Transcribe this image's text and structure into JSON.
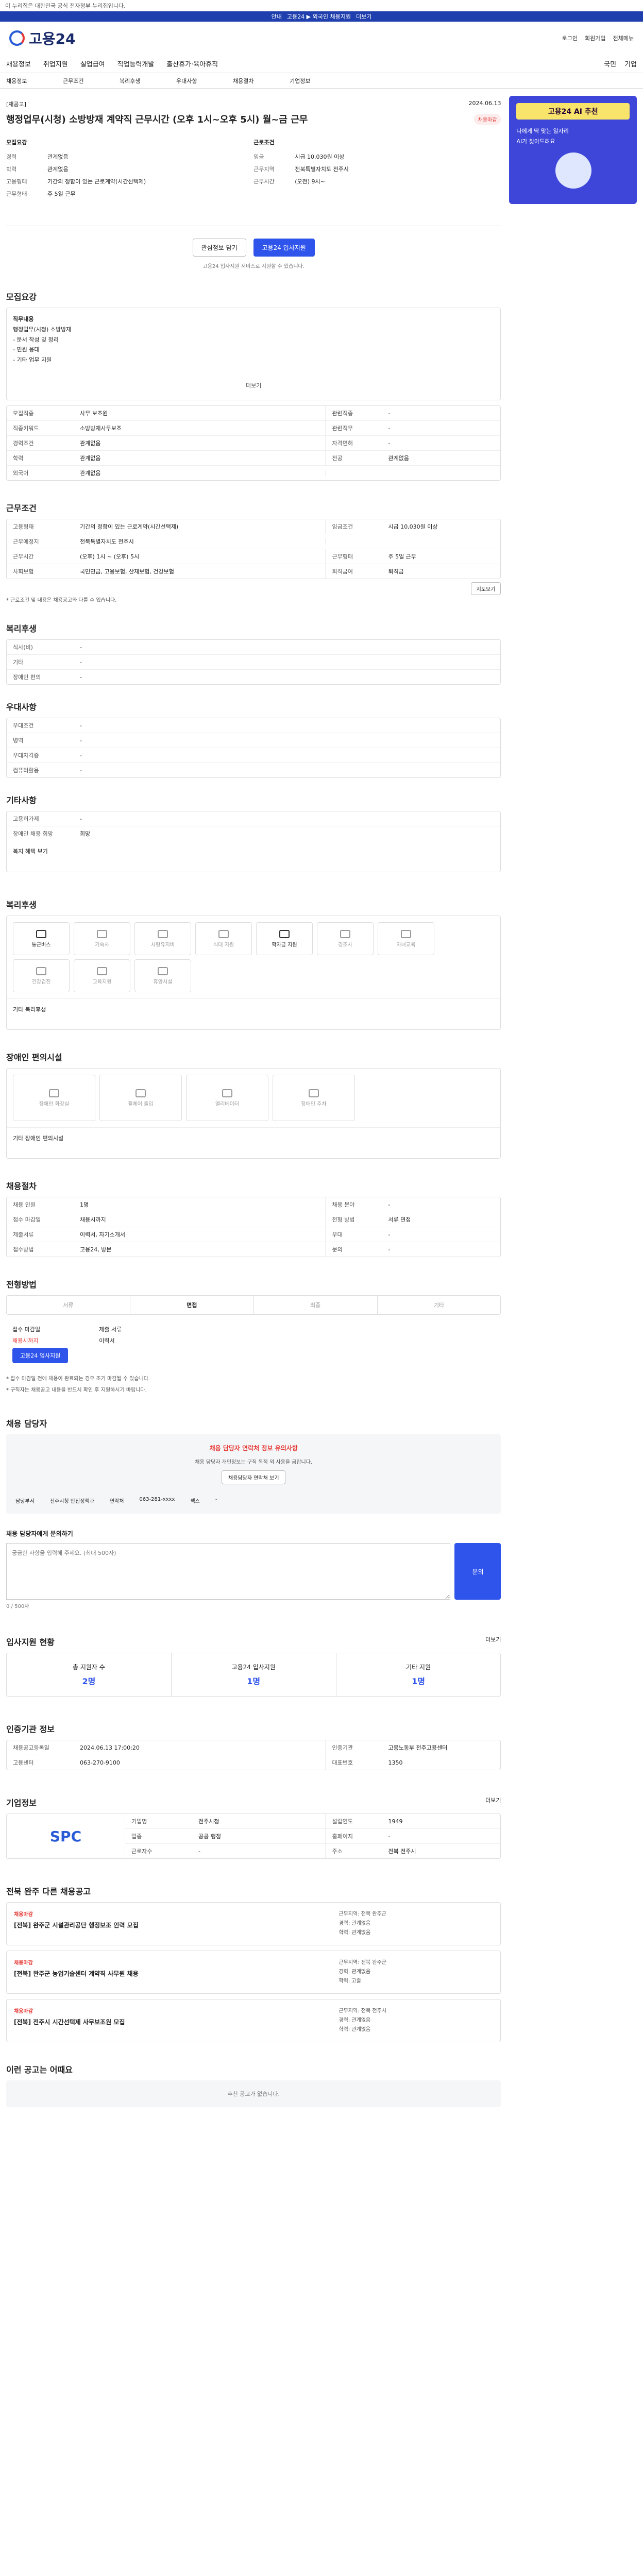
{
  "topbar": {
    "text": "이 누리집은 대한민국 공식 전자정부 누리집입니다."
  },
  "bluebar": {
    "badge": "안내",
    "text": "고용24 ▶ 외국인 채용지원",
    "more": "더보기"
  },
  "header": {
    "logo": "고용24",
    "util": [
      "로그인",
      "회원가입",
      "전체메뉴"
    ]
  },
  "gnb": {
    "items": [
      "채용정보",
      "취업지원",
      "실업급여",
      "직업능력개발",
      "출산휴가·육아휴직"
    ],
    "right": [
      "국민",
      "기업"
    ]
  },
  "subnav": {
    "items": [
      "채용정보",
      "근무조건",
      "복리후생",
      "우대사항",
      "채용절차",
      "기업정보"
    ]
  },
  "job": {
    "label": "[재공고]",
    "date": "2024.06.13",
    "title": "행정업무(시청) 소방방재 계약직 근무시간 (오후 1시~오후 5시) 월~금 근무",
    "status": "채용마감"
  },
  "summary": {
    "left": [
      [
        "경력",
        "관계없음"
      ],
      [
        "학력",
        "관계없음"
      ],
      [
        "고용형태",
        "기간의 정함이 있는 근로계약(시간선택제)"
      ],
      [
        "근무형태",
        "주 5일 근무"
      ]
    ],
    "right": [
      [
        "임금",
        "시급 10,030원 이상"
      ],
      [
        "근무지역",
        "전북특별자치도 전주시"
      ],
      [
        "근무시간",
        "(오전) 9시~"
      ]
    ],
    "tag_left": "모집요강",
    "tag_right": "근로조건"
  },
  "actions": {
    "scrap": "관심정보 담기",
    "apply": "고용24 입사지원",
    "notice": "고용24 입사지원 서비스로 지원할 수 있습니다."
  },
  "recruit": {
    "title": "모집요강",
    "duty_label": "직무내용",
    "duty": [
      "행정업무(시청) 소방방재",
      "- 문서 작성 및 정리",
      "- 민원 응대",
      "- 기타 업무 지원"
    ],
    "more": "더보기",
    "rows": [
      [
        "모집직종",
        "사무 보조원",
        "관련직종",
        "-"
      ],
      [
        "직종키워드",
        "소방방재사무보조",
        "관련직무",
        "-"
      ],
      [
        "경력조건",
        "관계없음",
        "자격면허",
        "-"
      ],
      [
        "학력",
        "관계없음",
        "전공",
        "관계없음"
      ],
      [
        "외국어",
        "관계없음",
        "",
        ""
      ]
    ]
  },
  "cond": {
    "title": "근무조건",
    "rows": [
      [
        "고용형태",
        "기간의 정함이 있는 근로계약(시간선택제)",
        "임금조건",
        "시급 10,030원 이상"
      ],
      [
        "근무예정지",
        "전북특별자치도 전주시",
        "",
        ""
      ],
      [
        "근무시간",
        "(오후) 1시 ~ (오후) 5시",
        "근무형태",
        "주 5일 근무"
      ],
      [
        "사회보험",
        "국민연금, 고용보험, 산재보험, 건강보험",
        "퇴직급여",
        "퇴직금"
      ]
    ],
    "map": "지도보기",
    "footnote": "* 근로조건 및 내용은 채용공고와 다를 수 있습니다."
  },
  "welfare_tbl": {
    "title": "복리후생",
    "rows": [
      [
        "식사(비)",
        "-"
      ],
      [
        "기타",
        "-"
      ],
      [
        "장애인 편의",
        "-"
      ]
    ]
  },
  "pref": {
    "title": "우대사항",
    "rows": [
      [
        "우대조건",
        "-"
      ],
      [
        "병역",
        "-"
      ],
      [
        "우대자격증",
        "-"
      ],
      [
        "컴퓨터활용",
        "-"
      ]
    ]
  },
  "extra": {
    "title": "기타사항",
    "rows": [
      [
        "고용허가제",
        "-"
      ],
      [
        "장애인 채용 희망",
        "희망"
      ]
    ],
    "more": "복지 혜택 보기"
  },
  "welfare_icons": {
    "title": "복리후생",
    "items": [
      "통근버스",
      "기숙사",
      "차량유지비",
      "식대 지원",
      "학자금 지원",
      "경조사",
      "자녀교육",
      "건강검진",
      "교육지원",
      "휴양시설"
    ],
    "sub_title": "기타 복리후생"
  },
  "disabled": {
    "title": "장애인 편의시설",
    "items": [
      "장애인 화장실",
      "휠체어 출입",
      "엘리베이터",
      "장애인 주차"
    ],
    "sub_title": "기타 장애인 편의시설"
  },
  "process": {
    "title": "채용절차",
    "rows": [
      [
        "채용 인원",
        "1명",
        "채용 분야",
        "-"
      ],
      [
        "접수 마감일",
        "채용시까지",
        "전형 방법",
        "서류 면접"
      ],
      [
        "제출서류",
        "이력서, 자기소개서",
        "우대",
        "-"
      ],
      [
        "접수방법",
        "고용24, 방문",
        "문의",
        "-"
      ]
    ]
  },
  "method": {
    "title": "전형방법",
    "tabs": [
      "서류",
      "면접",
      "최종",
      "기타"
    ],
    "apply_label": "접수 마감일",
    "apply_value": "채용시까지",
    "docs_label": "제출 서류",
    "docs_value": "이력서",
    "btn": "고용24 입사지원",
    "notes": [
      "* 접수 마감일 전에 채용이 완료되는 경우 조기 마감될 수 있습니다.",
      "* 구직자는 채용공고 내용을 반드시 확인 후 지원하시기 바랍니다."
    ]
  },
  "contact": {
    "title": "채용 담당자",
    "warn": "채용 담당자 연락처 정보 유의사항",
    "desc": "채용 담당자 개인정보는 구직 목적 외 사용을 금합니다.",
    "btn": "채용담당자 연락처 보기",
    "name_label": "담당부서",
    "name": "전주시청 안전정책과",
    "phone_label": "연락처",
    "phone": "063-281-xxxx",
    "fax_label": "팩스",
    "fax": "-"
  },
  "qna": {
    "title": "채용 담당자에게 문의하기",
    "placeholder": "궁금한 사항을 입력해 주세요. (최대 500자)",
    "btn": "문의",
    "count": "0 / 500자"
  },
  "status": {
    "title": "입사지원 현황",
    "more": "더보기",
    "items": [
      [
        "총 지원자 수",
        "2명"
      ],
      [
        "고용24 입사지원",
        "1명"
      ],
      [
        "기타 지원",
        "1명"
      ]
    ]
  },
  "inst": {
    "title": "인증기관 정보",
    "rows": [
      [
        "채용공고등록일",
        "2024.06.13 17:00:20",
        "인증기관",
        "고용노동부 전주고용센터"
      ],
      [
        "고용센터",
        "063-270-9100",
        "대표번호",
        "1350"
      ]
    ]
  },
  "company": {
    "title": "기업정보",
    "more": "더보기",
    "logo": "SPC",
    "rows": [
      [
        "기업명",
        "전주시청",
        "설립연도",
        "1949"
      ],
      [
        "업종",
        "공공 행정",
        "홈페이지",
        "-"
      ],
      [
        "근로자수",
        "-",
        "주소",
        "전북 전주시"
      ]
    ]
  },
  "others": {
    "title": "전북 완주 다른 채용공고",
    "items": [
      {
        "badge": "채용마감",
        "title": "[전북] 완주군 시설관리공단 행정보조 인력 모집",
        "r": [
          "근무지역: 전북 완주군",
          "경력: 관계없음",
          "학력: 관계없음"
        ]
      },
      {
        "badge": "채용마감",
        "title": "[전북] 완주군 농업기술센터 계약직 사무원 채용",
        "r": [
          "근무지역: 전북 완주군",
          "경력: 관계없음",
          "학력: 고졸"
        ]
      },
      {
        "badge": "채용마감",
        "title": "[전북] 전주시 시간선택제 사무보조원 모집",
        "r": [
          "근무지역: 전북 전주시",
          "경력: 관계없음",
          "학력: 관계없음"
        ]
      }
    ]
  },
  "footer": {
    "title": "이런 공고는 어때요",
    "empty": "추천 공고가 없습니다."
  },
  "side": {
    "tag": "고용24 AI 추천",
    "line1": "나에게 딱 맞는 일자리",
    "line2": "AI가 찾아드려요"
  }
}
